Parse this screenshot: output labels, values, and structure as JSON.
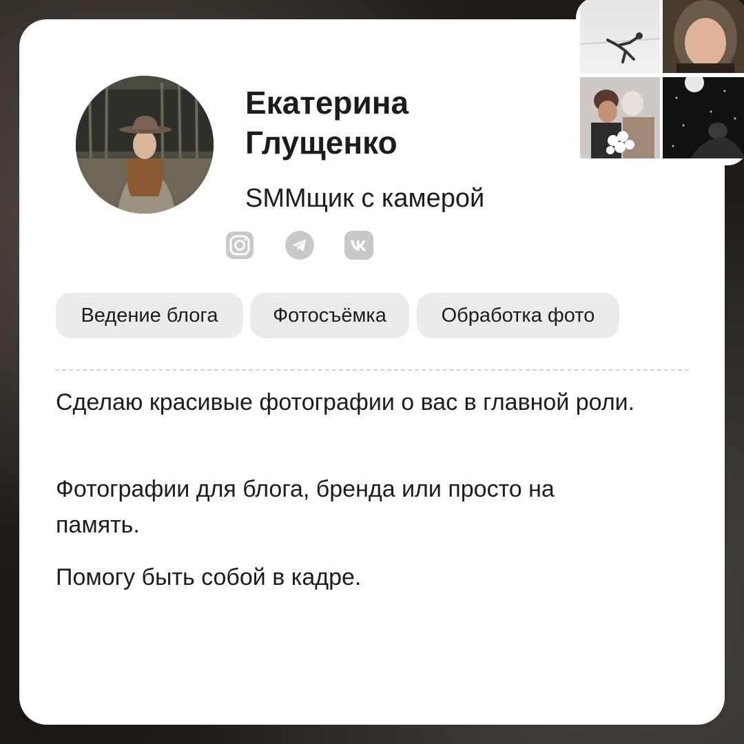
{
  "profile": {
    "name": "Екатерина Глущенко",
    "role": "SMMщик с камерой"
  },
  "social_icons": [
    "instagram-icon",
    "telegram-icon",
    "vk-icon"
  ],
  "tags": [
    "Ведение блога",
    "Фотосъёмка",
    "Обработка фото"
  ],
  "description": [
    "Сделаю красивые фотографии о вас в главной роли.",
    "Фотографии для блога, бренда или просто на память.",
    "Помогу быть собой в кадре."
  ],
  "colors": {
    "card": "#ffffff",
    "tag_background": "#ebebeb",
    "text": "#1c1c1c",
    "icon": "#c8c8c8"
  }
}
